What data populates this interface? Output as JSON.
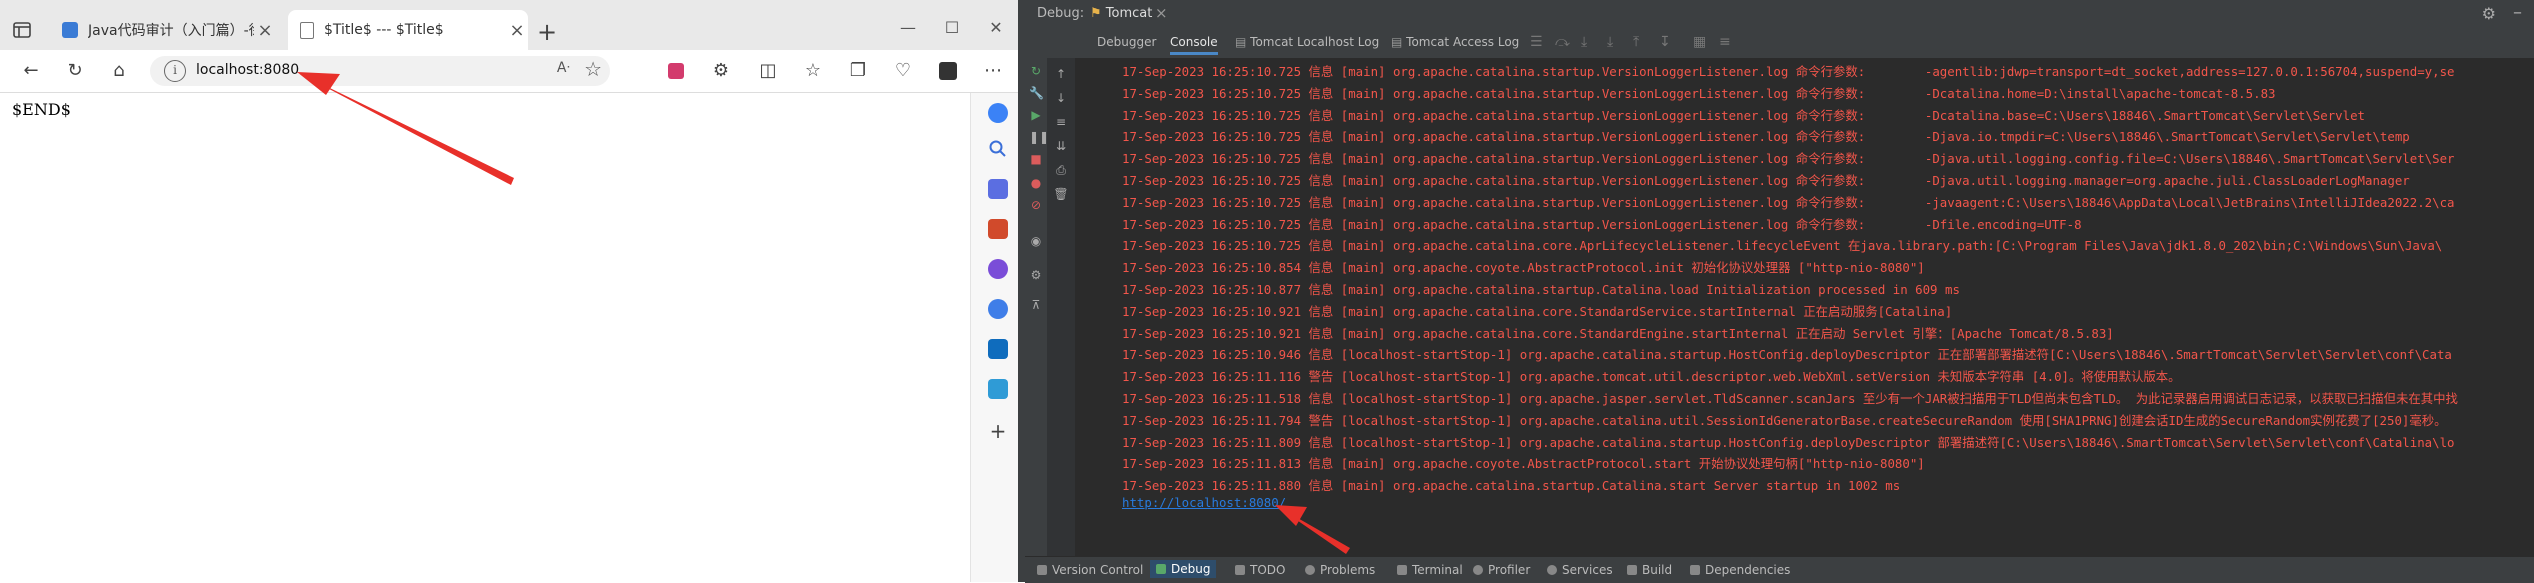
{
  "browser": {
    "tabs": [
      {
        "title": "Java代码审计（入门篇）-徐焱主",
        "active": false
      },
      {
        "title": "$Title$ --- $Title$",
        "active": true
      }
    ],
    "address": "localhost:8080",
    "page_content": "$END$"
  },
  "ide": {
    "window_title": "Debug:",
    "run_config": "Tomcat",
    "subtabs": [
      "Debugger",
      "Console",
      "Tomcat Localhost Log",
      "Tomcat Access Log"
    ],
    "console_lines": [
      "17-Sep-2023 16:25:10.725 信息 [main] org.apache.catalina.startup.VersionLoggerListener.log 命令行参数:        -agentlib:jdwp=transport=dt_socket,address=127.0.0.1:56704,suspend=y,se",
      "17-Sep-2023 16:25:10.725 信息 [main] org.apache.catalina.startup.VersionLoggerListener.log 命令行参数:        -Dcatalina.home=D:\\install\\apache-tomcat-8.5.83",
      "17-Sep-2023 16:25:10.725 信息 [main] org.apache.catalina.startup.VersionLoggerListener.log 命令行参数:        -Dcatalina.base=C:\\Users\\18846\\.SmartTomcat\\Servlet\\Servlet",
      "17-Sep-2023 16:25:10.725 信息 [main] org.apache.catalina.startup.VersionLoggerListener.log 命令行参数:        -Djava.io.tmpdir=C:\\Users\\18846\\.SmartTomcat\\Servlet\\Servlet\\temp",
      "17-Sep-2023 16:25:10.725 信息 [main] org.apache.catalina.startup.VersionLoggerListener.log 命令行参数:        -Djava.util.logging.config.file=C:\\Users\\18846\\.SmartTomcat\\Servlet\\Ser",
      "17-Sep-2023 16:25:10.725 信息 [main] org.apache.catalina.startup.VersionLoggerListener.log 命令行参数:        -Djava.util.logging.manager=org.apache.juli.ClassLoaderLogManager",
      "17-Sep-2023 16:25:10.725 信息 [main] org.apache.catalina.startup.VersionLoggerListener.log 命令行参数:        -javaagent:C:\\Users\\18846\\AppData\\Local\\JetBrains\\IntelliJIdea2022.2\\ca",
      "17-Sep-2023 16:25:10.725 信息 [main] org.apache.catalina.startup.VersionLoggerListener.log 命令行参数:        -Dfile.encoding=UTF-8",
      "17-Sep-2023 16:25:10.725 信息 [main] org.apache.catalina.core.AprLifecycleListener.lifecycleEvent 在java.library.path:[C:\\Program Files\\Java\\jdk1.8.0_202\\bin;C:\\Windows\\Sun\\Java\\",
      "17-Sep-2023 16:25:10.854 信息 [main] org.apache.coyote.AbstractProtocol.init 初始化协议处理器 [\"http-nio-8080\"]",
      "17-Sep-2023 16:25:10.877 信息 [main] org.apache.catalina.startup.Catalina.load Initialization processed in 609 ms",
      "17-Sep-2023 16:25:10.921 信息 [main] org.apache.catalina.core.StandardService.startInternal 正在启动服务[Catalina]",
      "17-Sep-2023 16:25:10.921 信息 [main] org.apache.catalina.core.StandardEngine.startInternal 正在启动 Servlet 引擎：[Apache Tomcat/8.5.83]",
      "17-Sep-2023 16:25:10.946 信息 [localhost-startStop-1] org.apache.catalina.startup.HostConfig.deployDescriptor 正在部署部署描述符[C:\\Users\\18846\\.SmartTomcat\\Servlet\\Servlet\\conf\\Cata",
      "17-Sep-2023 16:25:11.116 警告 [localhost-startStop-1] org.apache.tomcat.util.descriptor.web.WebXml.setVersion 未知版本字符串 [4.0]。将使用默认版本。",
      "17-Sep-2023 16:25:11.518 信息 [localhost-startStop-1] org.apache.jasper.servlet.TldScanner.scanJars 至少有一个JAR被扫描用于TLD但尚未包含TLD。 为此记录器启用调试日志记录，以获取已扫描但未在其中找",
      "17-Sep-2023 16:25:11.794 警告 [localhost-startStop-1] org.apache.catalina.util.SessionIdGeneratorBase.createSecureRandom 使用[SHA1PRNG]创建会话ID生成的SecureRandom实例花费了[250]毫秒。",
      "17-Sep-2023 16:25:11.809 信息 [localhost-startStop-1] org.apache.catalina.startup.HostConfig.deployDescriptor 部署描述符[C:\\Users\\18846\\.SmartTomcat\\Servlet\\Servlet\\conf\\Catalina\\lo",
      "17-Sep-2023 16:25:11.813 信息 [main] org.apache.coyote.AbstractProtocol.start 开始协议处理句柄[\"http-nio-8080\"]",
      "17-Sep-2023 16:25:11.880 信息 [main] org.apache.catalina.startup.Catalina.start Server startup in 1002 ms"
    ],
    "server_url": "http://localhost:8080/",
    "statusbar": [
      "Version Control",
      "Debug",
      "TODO",
      "Problems",
      "Terminal",
      "Profiler",
      "Services",
      "Build",
      "Dependencies"
    ]
  },
  "colors": {
    "log_text": "#f2564b",
    "link": "#287bde",
    "arrow": "#e8302a",
    "ide_bg": "#2b2b2b"
  }
}
